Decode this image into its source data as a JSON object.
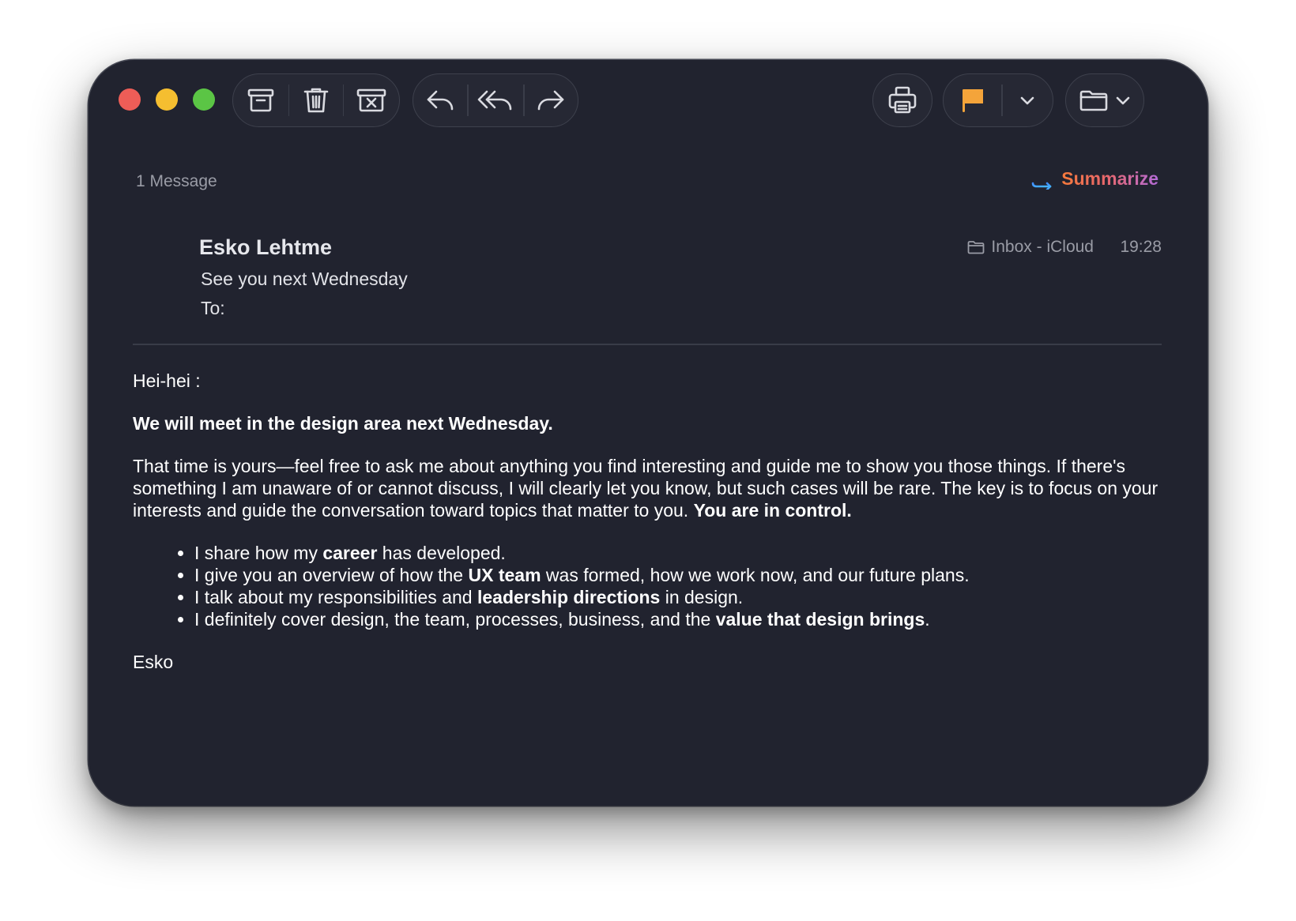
{
  "toolbar": {
    "icons": [
      "archive-icon",
      "trash-icon",
      "junk-icon",
      "reply-icon",
      "reply-all-icon",
      "forward-icon",
      "print-icon",
      "flag-icon",
      "chevron-down-icon",
      "folder-icon",
      "chevron-down-icon"
    ],
    "flag_color": "#f4a43a"
  },
  "thread": {
    "message_count": "1 Message",
    "summarize_label": "Summarize"
  },
  "message": {
    "sender": "Esko Lehtme",
    "subject": "See you next Wednesday",
    "to_label": "To:",
    "mailbox": "Inbox - iCloud",
    "time": "19:28"
  },
  "body": {
    "greeting": "Hei-hei :",
    "headline": "We will meet in the design area next Wednesday.",
    "para1": "That time is yours—feel free to ask me about anything you find interesting and guide me to show you those things. If there's something I am unaware of or cannot discuss, I will clearly let you know, but such cases will be rare. The key is to focus on your interests and guide the conversation toward topics that matter to you.",
    "para1_bold": "You are in control.",
    "bullets": [
      {
        "pre": "I share how my ",
        "bold": "career",
        "post": " has developed."
      },
      {
        "pre": "I give you an overview of how the ",
        "bold": "UX team",
        "post": " was formed, how we work now, and our future plans."
      },
      {
        "pre": "I talk about my responsibilities and ",
        "bold": "leadership directions",
        "post": " in design."
      },
      {
        "pre": "I definitely cover design, the team, processes, business, and the ",
        "bold": "value that design brings",
        "post": "."
      }
    ],
    "signature": "Esko"
  }
}
